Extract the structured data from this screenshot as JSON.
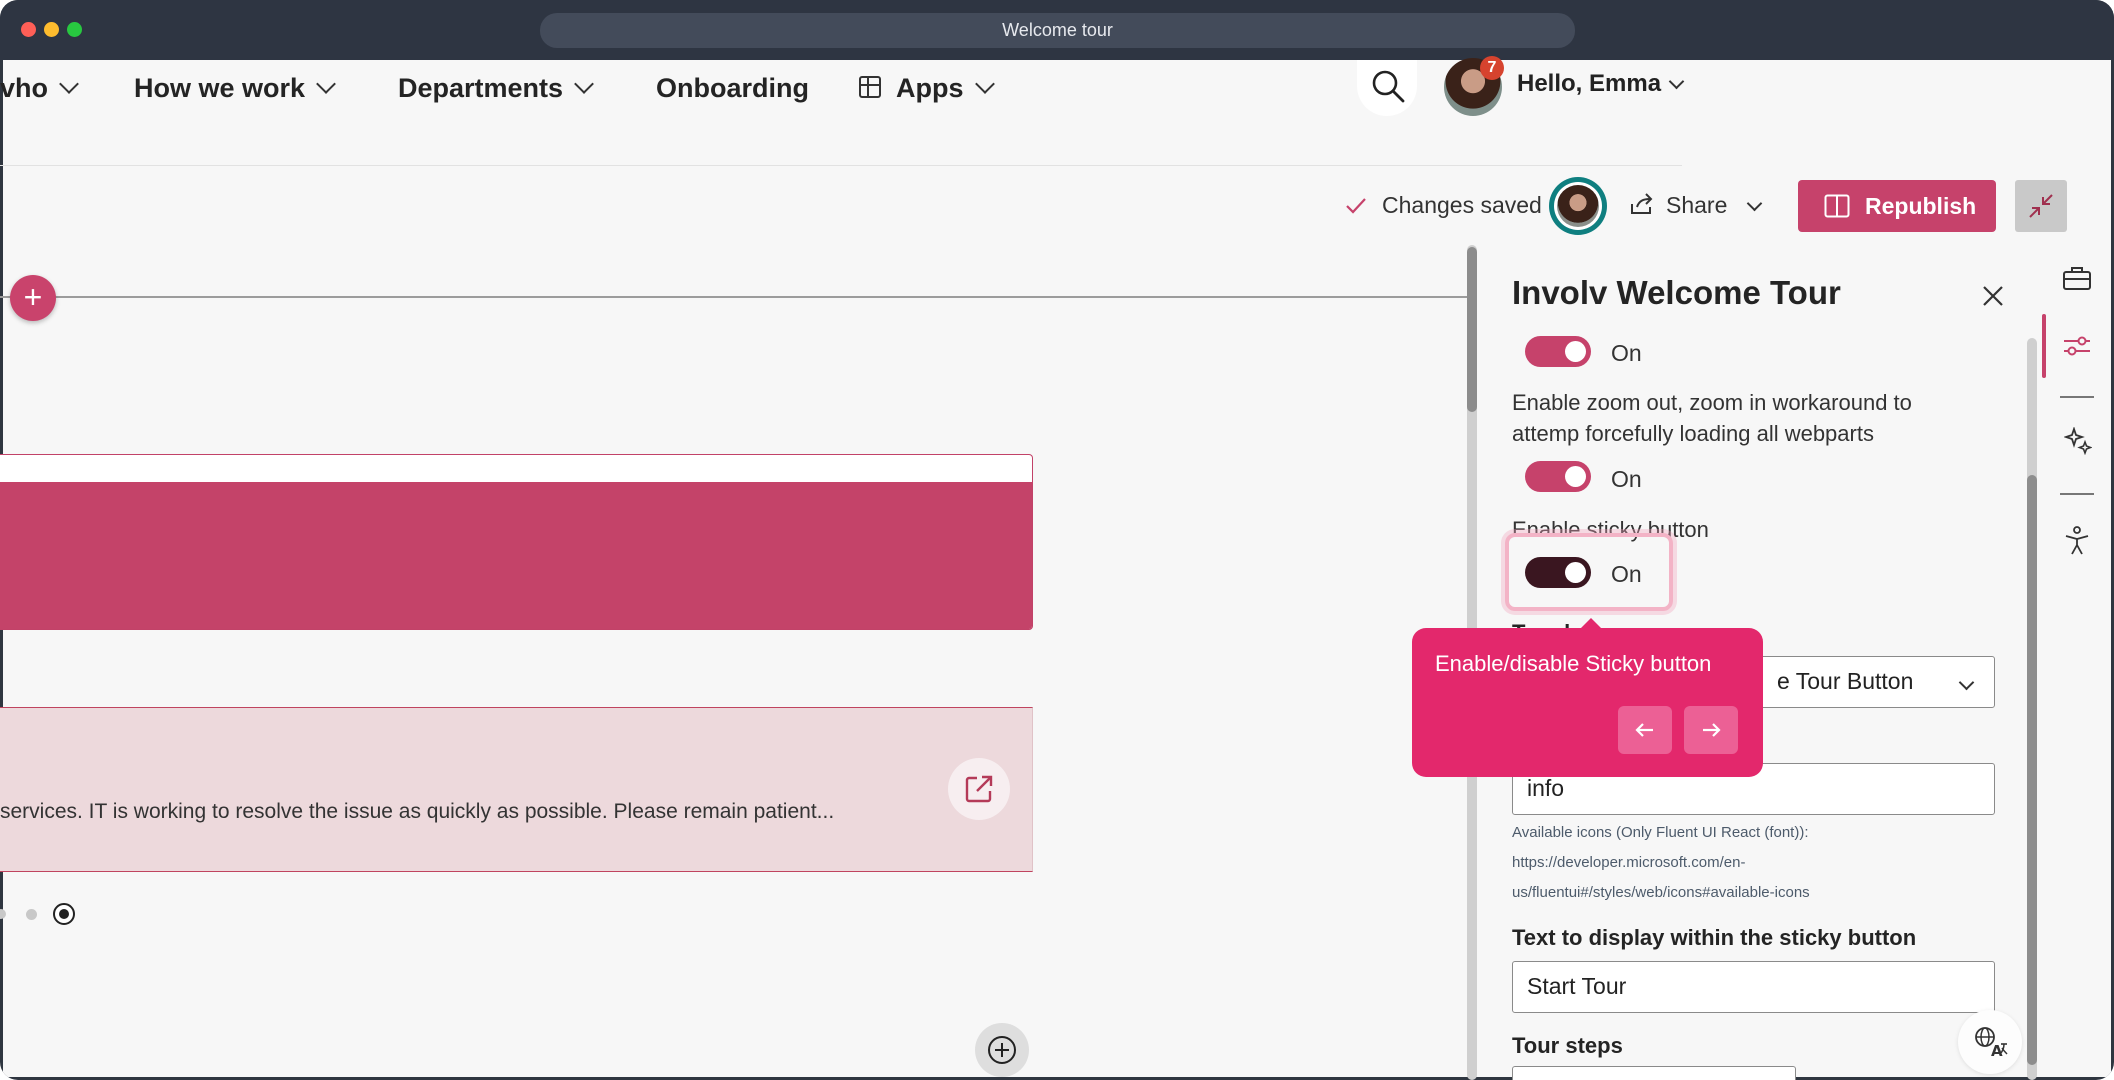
{
  "window": {
    "title": "Welcome tour"
  },
  "nav": {
    "items": [
      {
        "label": "vho"
      },
      {
        "label": "How we work"
      },
      {
        "label": "Departments"
      },
      {
        "label": "Onboarding"
      },
      {
        "label": "Apps"
      }
    ],
    "greeting": "Hello, Emma",
    "notification_count": "7"
  },
  "toolbar": {
    "status": "Changes saved",
    "share_label": "Share",
    "republish_label": "Republish"
  },
  "canvas": {
    "alert_text": "services. IT is working to resolve the issue as quickly as possible. Please remain patient..."
  },
  "panel": {
    "title": "Involv Welcome Tour",
    "toggle1_state": "On",
    "zoom_desc": "Enable zoom out, zoom in workaround to attemp forcefully loading all webparts",
    "toggle2_state": "On",
    "sticky_label": "Enable sticky button",
    "sticky_state": "On",
    "hidden_label": "Toggle",
    "dropdown_value": "e Tour Button",
    "icon_value": "info",
    "icons_help": "Available icons (Only Fluent UI React (font)):",
    "icons_link_line1": "https://developer.microsoft.com/en-",
    "icons_link_line2": "us/fluentui#/styles/web/icons#available-icons",
    "sticky_text_label": "Text to display within the sticky button",
    "sticky_text_value": "Start Tour",
    "tour_steps_label": "Tour steps"
  },
  "tooltip": {
    "text": "Enable/disable Sticky button"
  },
  "colors": {
    "accent": "#c6426b",
    "tooltip": "#e3286c",
    "titlebar": "#2e3542"
  },
  "icons": [
    "search-icon",
    "chevron-down-icon",
    "apps-grid-icon",
    "share-icon",
    "book-icon",
    "collapse-icon",
    "close-icon",
    "briefcase-icon",
    "sliders-icon",
    "sparkle-icon",
    "accessibility-icon",
    "external-link-icon",
    "plus-icon",
    "translate-icon",
    "arrow-left-icon",
    "arrow-right-icon",
    "checkmark-icon"
  ]
}
